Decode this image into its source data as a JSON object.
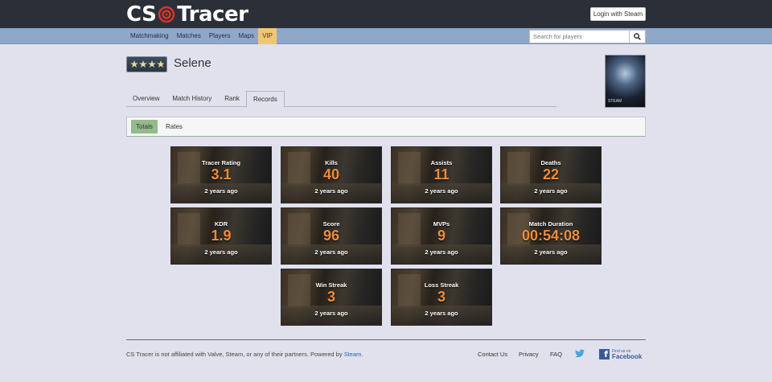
{
  "header": {
    "logo_left": "CS",
    "logo_right": "Tracer",
    "login_label": "Login with Steam"
  },
  "nav": {
    "items": [
      {
        "label": "Matchmaking"
      },
      {
        "label": "Matches"
      },
      {
        "label": "Players"
      },
      {
        "label": "Maps"
      },
      {
        "label": "VIP"
      }
    ],
    "search_placeholder": "Search for players"
  },
  "profile": {
    "name": "Selene",
    "avatar_caption": "STEAM"
  },
  "tabs": [
    {
      "label": "Overview"
    },
    {
      "label": "Match History"
    },
    {
      "label": "Rank"
    },
    {
      "label": "Records",
      "active": true
    }
  ],
  "subtabs": [
    {
      "label": "Totals",
      "active": true
    },
    {
      "label": "Rates"
    }
  ],
  "records": [
    {
      "title": "Tracer Rating",
      "value": "3.1",
      "date": "2 years ago"
    },
    {
      "title": "Kills",
      "value": "40",
      "date": "2 years ago"
    },
    {
      "title": "Assists",
      "value": "11",
      "date": "2 years ago"
    },
    {
      "title": "Deaths",
      "value": "22",
      "date": "2 years ago"
    },
    {
      "title": "KDR",
      "value": "1.9",
      "date": "2 years ago"
    },
    {
      "title": "Score",
      "value": "96",
      "date": "2 years ago"
    },
    {
      "title": "MVPs",
      "value": "9",
      "date": "2 years ago"
    },
    {
      "title": "Match Duration",
      "value": "00:54:08",
      "date": "2 years ago"
    },
    {
      "title": "Win Streak",
      "value": "3",
      "date": "2 years ago"
    },
    {
      "title": "Loss Streak",
      "value": "3",
      "date": "2 years ago"
    }
  ],
  "footer": {
    "disclaimer": "CS Tracer is not affiliated with Valve, Steam, or any of their partners. Powered by ",
    "steam_link": "Steam",
    "period": ".",
    "links": [
      {
        "label": "Contact Us"
      },
      {
        "label": "Privacy"
      },
      {
        "label": "FAQ"
      }
    ],
    "facebook_small": "Find us on",
    "facebook_big": "Facebook"
  },
  "colors": {
    "accent_orange": "#f08c3a",
    "nav_blue": "#8fa8c9",
    "vip_gold": "#f2c66f",
    "active_green": "#94bb8b",
    "header_dark": "#2b2f38"
  }
}
